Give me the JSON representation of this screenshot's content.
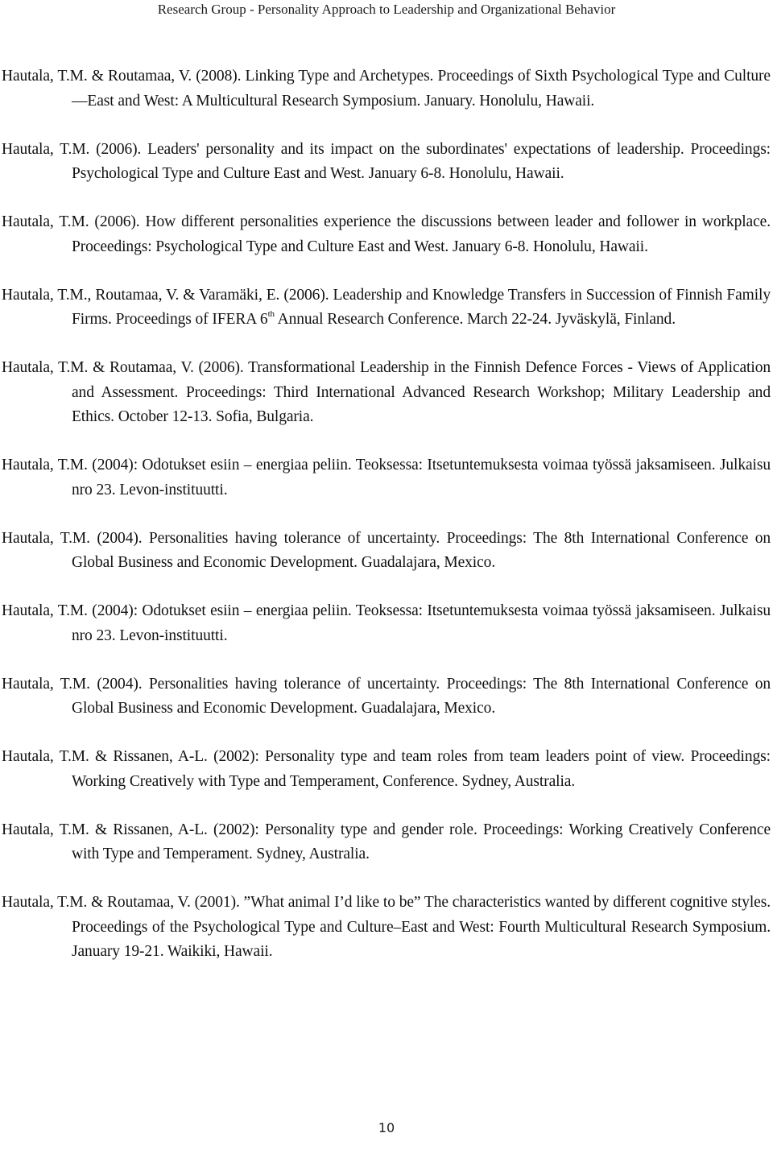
{
  "header": {
    "title": "Research Group - Personality Approach to Leadership and Organizational Behavior"
  },
  "references": [
    {
      "text": "Hautala, T.M. & Routamaa, V. (2008). Linking Type and Archetypes. Proceedings of Sixth Psychological Type and Culture—East and West: A Multicultural Research Symposium. January. Honolulu, Hawaii."
    },
    {
      "text": "Hautala, T.M. (2006). Leaders' personality and its impact on the subordinates' expectations of leadership. Proceedings: Psychological Type and Culture East and West. January 6-8. Honolulu, Hawaii."
    },
    {
      "text": "Hautala, T.M. (2006). How different personalities experience the discussions between leader and follower in workplace. Proceedings: Psychological Type and Culture East and West. January 6-8. Honolulu, Hawaii."
    },
    {
      "text_before_sup": "Hautala, T.M., Routamaa, V. & Varamäki, E. (2006). Leadership and Knowledge Transfers in Succession of Finnish Family Firms. Proceedings of IFERA 6",
      "sup": "th",
      "text_after_sup": " Annual Research Conference. March 22-24. Jyväskylä, Finland."
    },
    {
      "text": "Hautala, T.M. & Routamaa, V. (2006). Transformational Leadership in the Finnish Defence Forces - Views of Application and Assessment. Proceedings: Third International Advanced Research Workshop; Military Leadership and Ethics. October 12-13. Sofia, Bulgaria."
    },
    {
      "text": "Hautala, T.M. (2004): Odotukset esiin – energiaa peliin. Teoksessa: Itsetuntemuksesta voimaa työssä jaksamiseen. Julkaisu nro 23. Levon-instituutti."
    },
    {
      "text": "Hautala, T.M. (2004). Personalities having tolerance of uncertainty. Proceedings: The 8th International Conference on Global Business and Economic Development. Guadalajara, Mexico."
    },
    {
      "text": "Hautala, T.M. (2004): Odotukset esiin – energiaa peliin. Teoksessa: Itsetuntemuksesta voimaa työssä jaksamiseen. Julkaisu nro 23. Levon-instituutti."
    },
    {
      "text": "Hautala, T.M. (2004). Personalities having tolerance of uncertainty. Proceedings: The 8th International Conference on Global Business and Economic Development. Guadalajara, Mexico."
    },
    {
      "text": "Hautala, T.M. & Rissanen, A-L. (2002): Personality type and team roles from team leaders point of view. Proceedings: Working Creatively with Type and Temperament, Conference. Sydney, Australia."
    },
    {
      "text": "Hautala, T.M. & Rissanen, A-L. (2002): Personality type and gender role. Proceedings: Working Creatively Conference with Type and Temperament. Sydney, Australia."
    },
    {
      "text": "Hautala, T.M. & Routamaa, V. (2001). ”What animal I’d like to be” The characteristics wanted by different cognitive styles. Proceedings of the Psychological Type and Culture–East and West: Fourth Multicultural Research Symposium. January 19-21. Waikiki, Hawaii."
    }
  ],
  "footer": {
    "page_number": "10"
  }
}
